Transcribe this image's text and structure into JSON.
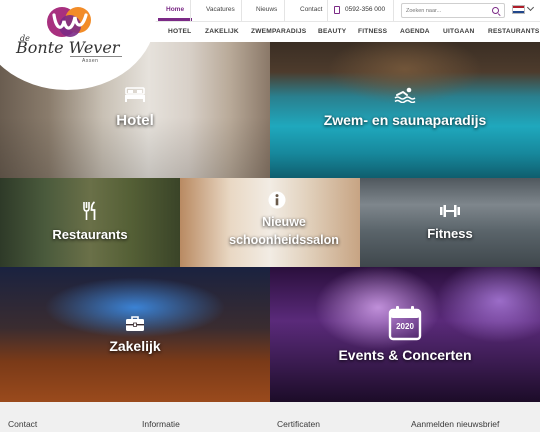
{
  "brand": {
    "name_prefix": "de",
    "name": "Bonte Wever",
    "city": "Assen",
    "colors": {
      "purple": "#7b2a86",
      "orange": "#f28c28",
      "text": "#3b3b3b"
    }
  },
  "topbar": {
    "links": [
      "Home",
      "Vacatures",
      "Nieuws",
      "Contact"
    ],
    "active": "Home",
    "phone": "0592-356 000",
    "phone_icon": "phone-icon",
    "search": {
      "placeholder": "Zoeken naar...",
      "icon": "search-icon"
    },
    "language": {
      "flag": "dutch-flag-icon",
      "dropdown_icon": "chevron-down-icon"
    }
  },
  "mainnav": {
    "items": [
      "HOTEL",
      "ZAKELIJK",
      "ZWEMPARADIJS",
      "BEAUTY",
      "FITNESS",
      "AGENDA",
      "UITGAAN",
      "RESTAURANTS"
    ]
  },
  "tiles": [
    {
      "id": "hotel",
      "label": "Hotel",
      "icon": "bed-icon"
    },
    {
      "id": "zwem",
      "label": "Zwem- en saunaparadijs",
      "icon": "swimming-icon"
    },
    {
      "id": "restaurants",
      "label": "Restaurants",
      "icon": "cutlery-icon"
    },
    {
      "id": "schoonheidssalon",
      "label_line1": "Nieuwe",
      "label_line2": "schoonheidssalon",
      "icon": "info-icon"
    },
    {
      "id": "fitness",
      "label": "Fitness",
      "icon": "dumbbell-icon"
    },
    {
      "id": "zakelijk",
      "label": "Zakelijk",
      "icon": "briefcase-icon"
    },
    {
      "id": "events",
      "label": "Events & Concerten",
      "icon": "calendar-icon",
      "icon_text": "2020"
    }
  ],
  "footer": {
    "columns": [
      "Contact",
      "Informatie",
      "Certificaten",
      "Aanmelden nieuwsbrief"
    ]
  }
}
